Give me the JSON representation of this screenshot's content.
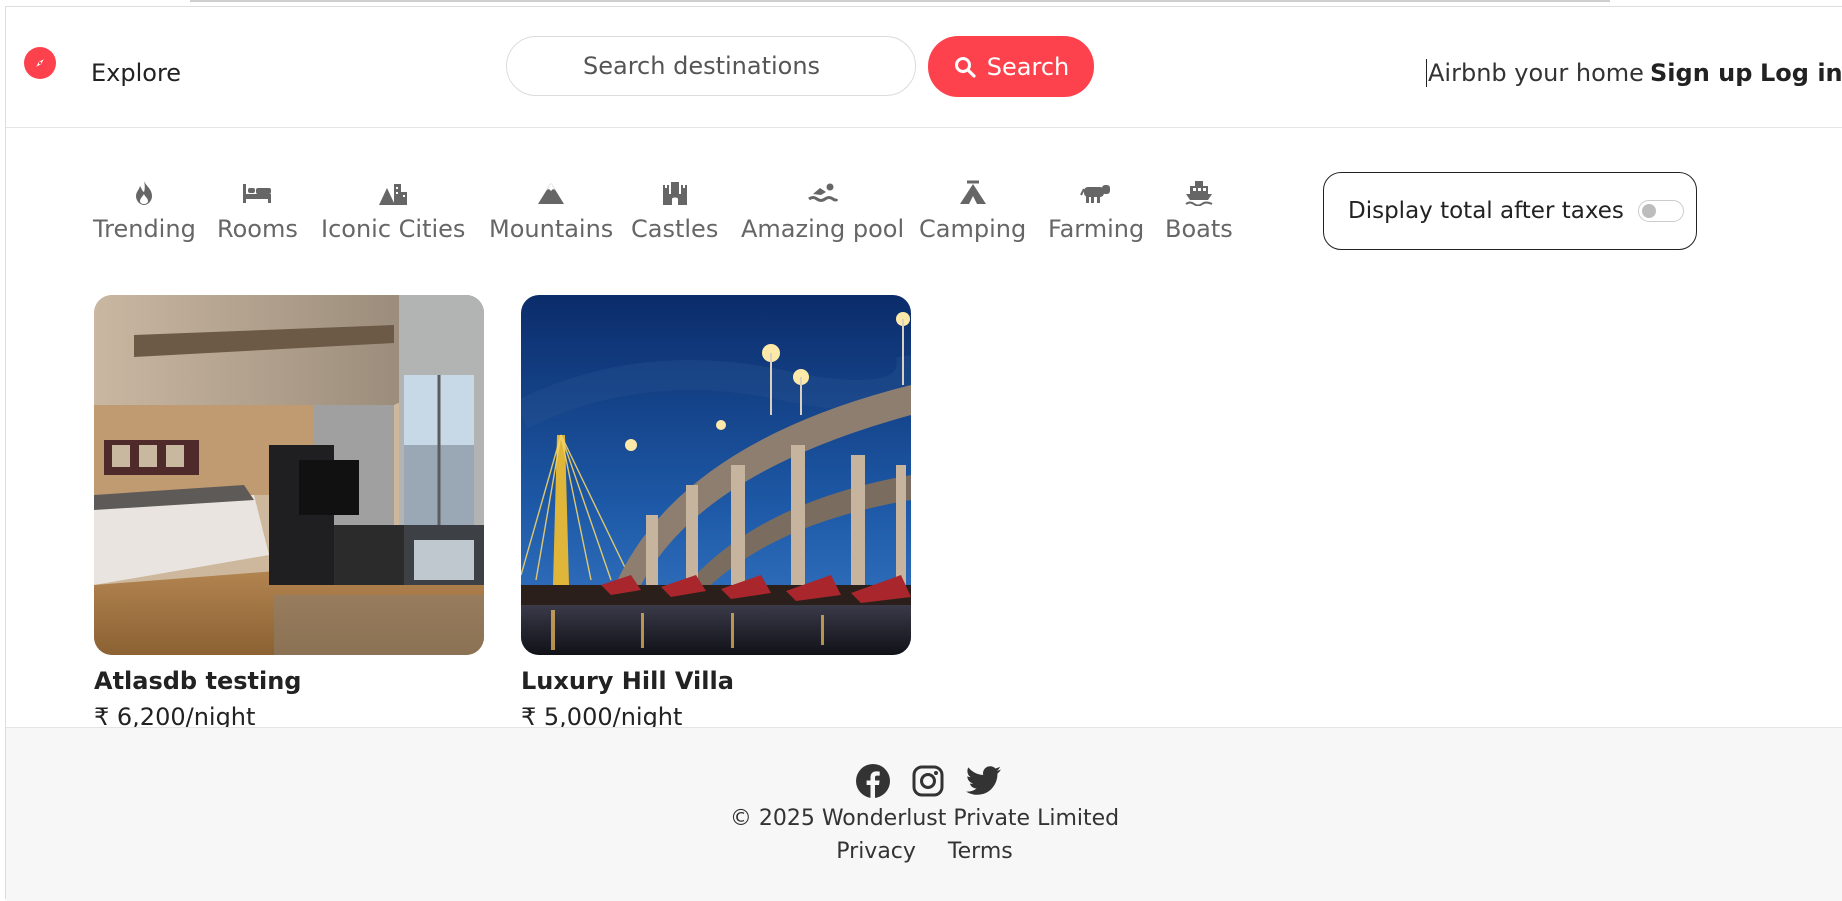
{
  "navbar": {
    "logo_icon": "compass-icon",
    "explore_label": "Explore",
    "search_placeholder": "Search destinations",
    "search_button_label": "Search",
    "airbnb_home_label": "Airbnb your home",
    "signup_label": "Sign up",
    "login_label": "Log in",
    "accent_color": "#fe424d"
  },
  "filters": [
    {
      "label": "Trending",
      "icon": "fire-icon"
    },
    {
      "label": "Rooms",
      "icon": "bed-icon"
    },
    {
      "label": "Iconic Cities",
      "icon": "mountain-city-icon"
    },
    {
      "label": "Mountains",
      "icon": "mountain-icon"
    },
    {
      "label": "Castles",
      "icon": "fort-icon"
    },
    {
      "label": "Amazing pool",
      "icon": "person-swimming-icon"
    },
    {
      "label": "Camping",
      "icon": "campground-icon"
    },
    {
      "label": "Farming",
      "icon": "cow-icon"
    },
    {
      "label": "Boats",
      "icon": "ship-icon"
    }
  ],
  "tax_toggle": {
    "label": "Display total after taxes",
    "checked": false
  },
  "listings": [
    {
      "title": "Atlasdb testing",
      "price": "₹ 6,200/night",
      "image": "hotel-room-photo"
    },
    {
      "title": "Luxury Hill Villa",
      "price": "₹ 5,000/night",
      "image": "night-bridge-photo"
    }
  ],
  "footer": {
    "social_icons": [
      "facebook-icon",
      "instagram-icon",
      "twitter-icon"
    ],
    "copyright": "© 2025 Wonderlust Private Limited",
    "links": [
      "Privacy",
      "Terms"
    ]
  }
}
